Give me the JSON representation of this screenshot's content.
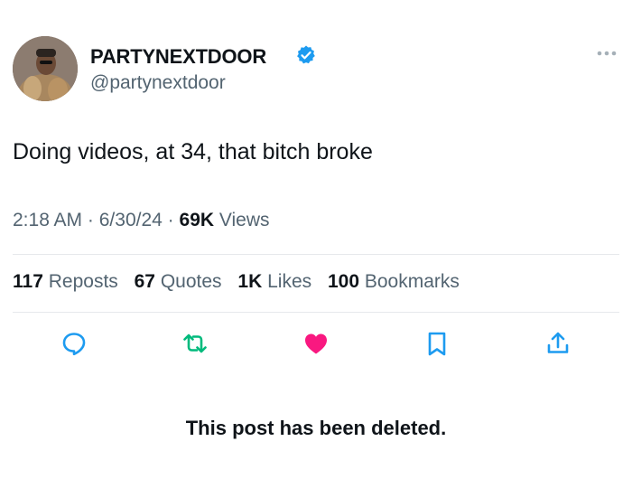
{
  "post": {
    "author": {
      "display_name": "PARTYNEXTDOOR",
      "handle": "@partynextdoor",
      "verified": true,
      "verified_color": "#1d9bf0"
    },
    "text": "Doing videos, at 34, that bitch broke",
    "meta": {
      "time": "2:18 AM",
      "separator": "·",
      "date": "6/30/24",
      "views_count": "69K",
      "views_label": "Views"
    },
    "stats": [
      {
        "count": "117",
        "label": "Reposts"
      },
      {
        "count": "67",
        "label": "Quotes"
      },
      {
        "count": "1K",
        "label": "Likes"
      },
      {
        "count": "100",
        "label": "Bookmarks"
      }
    ],
    "actions": [
      {
        "icon": "reply-icon",
        "color": "#1d9bf0"
      },
      {
        "icon": "repost-icon",
        "color": "#00ba7c"
      },
      {
        "icon": "like-icon",
        "color": "#f91880",
        "active": true
      },
      {
        "icon": "bookmark-icon",
        "color": "#1d9bf0"
      },
      {
        "icon": "share-icon",
        "color": "#1d9bf0"
      }
    ],
    "deleted_notice": "This post has been deleted."
  }
}
